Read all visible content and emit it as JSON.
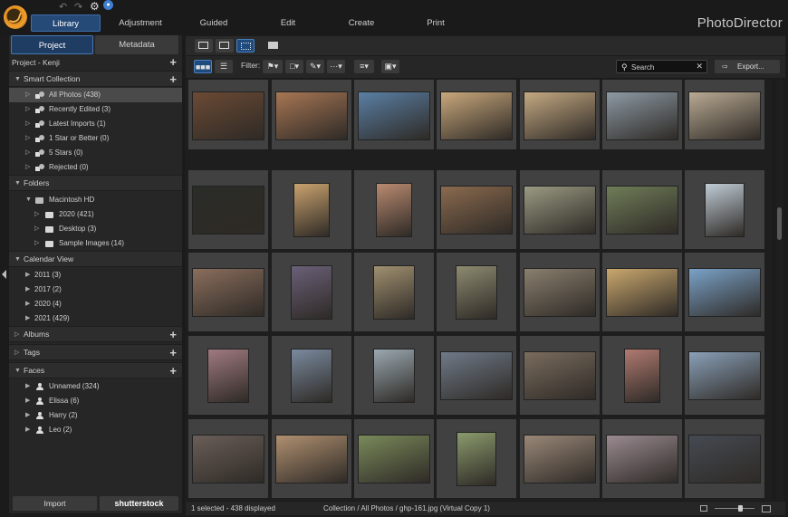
{
  "app": {
    "brand": "PhotoDirector",
    "mode_tabs": [
      "Library",
      "Adjustment",
      "Guided",
      "Edit",
      "Create",
      "Print"
    ],
    "active_mode": "Library"
  },
  "top_icons": [
    "undo-icon",
    "redo-icon",
    "settings-gear-icon",
    "notification-bell-icon"
  ],
  "left_panel": {
    "tabs": [
      "Project",
      "Metadata"
    ],
    "project_title": "Project - Kenji",
    "smart_collection": {
      "title": "Smart Collection",
      "items": [
        "All Photos (438)",
        "Recently Edited (3)",
        "Latest Imports (1)",
        "1 Star or Better (0)",
        "5 Stars (0)",
        "Rejected (0)"
      ]
    },
    "folders": {
      "title": "Folders",
      "root": "Macintosh HD",
      "items": [
        "2020 (421)",
        "Desktop (3)",
        "Sample Images (14)"
      ]
    },
    "calendar": {
      "title": "Calendar View",
      "items": [
        "2011 (3)",
        "2017 (2)",
        "2020 (4)",
        "2021 (429)"
      ]
    },
    "albums": "Albums",
    "tags": "Tags",
    "faces": {
      "title": "Faces",
      "items": [
        "Unnamed (324)",
        "Elissa (6)",
        "Harry (2)",
        "Leo (2)"
      ]
    },
    "import_label": "Import",
    "shutterstock_label": "shutterstock"
  },
  "filter_bar": {
    "filter_label": "Filter:",
    "search_placeholder": "Search",
    "export_label": "Export..."
  },
  "status": {
    "left": "1 selected - 438 displayed",
    "center": "Collection / All Photos / ghp-161.jpg (Virtual Copy 1)"
  },
  "colors": {
    "accent": "#264a78",
    "panel": "#262626",
    "cell": "#414141"
  }
}
